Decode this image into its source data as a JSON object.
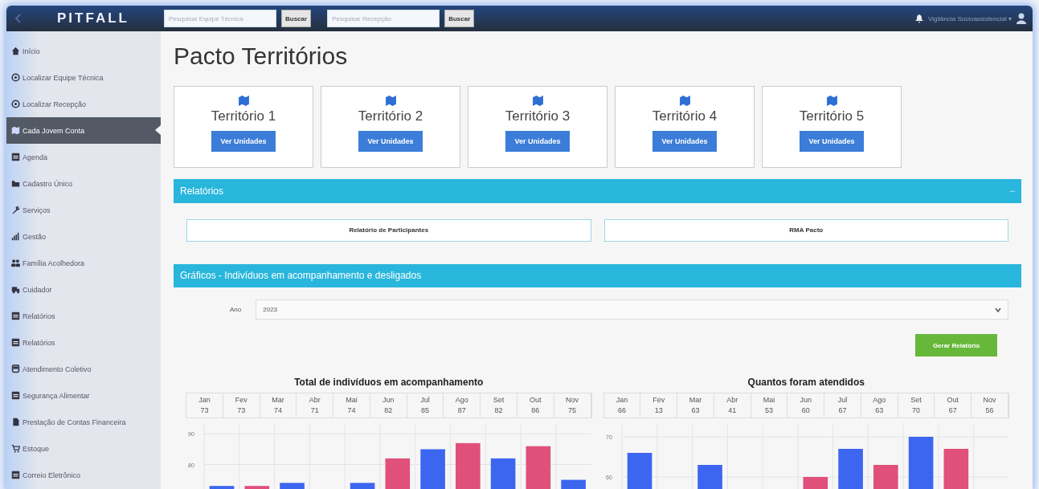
{
  "navbar": {
    "logo": "PITFALL",
    "searches": [
      {
        "placeholder": "Pesquisar Equipe Técnica",
        "button": "Buscar"
      },
      {
        "placeholder": "Pesquisar Recepção",
        "button": "Buscar"
      }
    ],
    "user": "Vigilância Socioassistencial",
    "user_caret": "▾"
  },
  "sidebar": {
    "items": [
      {
        "label": "Início",
        "kind": "home",
        "selected": false
      },
      {
        "label": "Localizar Equipe Técnica",
        "kind": "circle",
        "selected": false
      },
      {
        "label": "Localizar Recepção",
        "kind": "circle",
        "selected": false
      },
      {
        "label": "Cada Jovem Conta",
        "kind": "map",
        "selected": true
      },
      {
        "label": "Agenda",
        "kind": "list",
        "selected": false
      },
      {
        "label": "Cadastro Único",
        "kind": "folder",
        "selected": false
      },
      {
        "label": "Serviços",
        "kind": "wrench",
        "selected": false
      },
      {
        "label": "Gestão",
        "kind": "chart",
        "selected": false
      },
      {
        "label": "Família Acolhedora",
        "kind": "users",
        "selected": false
      },
      {
        "label": "Cuidador",
        "kind": "truck",
        "selected": false
      },
      {
        "label": "Relatórios",
        "kind": "list",
        "selected": false
      },
      {
        "label": "Relatórios",
        "kind": "list",
        "selected": false
      },
      {
        "label": "Atendimento Coletivo",
        "kind": "bus",
        "selected": false
      },
      {
        "label": "Segurança Alimentar",
        "kind": "list",
        "selected": false
      },
      {
        "label": "Prestação de Contas Financeira",
        "kind": "file",
        "selected": false
      },
      {
        "label": "Estoque",
        "kind": "cart",
        "selected": false
      },
      {
        "label": "Correio Eletrônico",
        "kind": "list",
        "selected": false
      }
    ]
  },
  "page": {
    "title": "Pacto Territórios",
    "territories": [
      {
        "name": "Território 1",
        "button": "Ver Unidades"
      },
      {
        "name": "Território 2",
        "button": "Ver Unidades"
      },
      {
        "name": "Território 3",
        "button": "Ver Unidades"
      },
      {
        "name": "Território 4",
        "button": "Ver Unidades"
      },
      {
        "name": "Território 5",
        "button": "Ver Unidades"
      }
    ],
    "reports_panel": {
      "title": "Relatórios",
      "collapse": "−",
      "buttons": [
        "Relatório de Participantes",
        "RMA Pacto"
      ]
    },
    "charts_panel": {
      "title": "Gráficos - Indivíduos em acompanhamento e desligados",
      "year_label": "Ano",
      "year": "2023",
      "generate_button": "Gerar Relatório",
      "charts": [
        {
          "title": "Total de indivíduos em acompanhamento",
          "months": [
            "Jan",
            "Fev",
            "Mar",
            "Abr",
            "Mai",
            "Jun",
            "Jul",
            "Ago",
            "Set",
            "Out",
            "Nov"
          ],
          "counts": [
            "73",
            "73",
            "74",
            "71",
            "74",
            "82",
            "85",
            "87",
            "82",
            "86",
            "75"
          ],
          "chart_data": {
            "type": "bar",
            "ylim": [
              72,
              93
            ],
            "yticks": [
              80,
              90
            ],
            "series": [
              {
                "color": "#3d66f0",
                "values": [
                  73,
                  null,
                  74,
                  null,
                  74,
                  null,
                  85,
                  null,
                  82,
                  null,
                  75
                ]
              },
              {
                "color": "#e0507a",
                "values": [
                  null,
                  73,
                  null,
                  null,
                  null,
                  82,
                  null,
                  87,
                  null,
                  86,
                  null
                ]
              }
            ]
          }
        },
        {
          "title": "Quantos foram atendidos",
          "months": [
            "Jan",
            "Fev",
            "Mar",
            "Abr",
            "Mai",
            "Jun",
            "Jul",
            "Ago",
            "Set",
            "Out",
            "Nov"
          ],
          "counts": [
            "66",
            "13",
            "63",
            "41",
            "53",
            "60",
            "67",
            "63",
            "70",
            "67",
            "56"
          ],
          "chart_data": {
            "type": "bar",
            "ylim": [
              57,
              73
            ],
            "yticks": [
              60,
              70
            ],
            "series": [
              {
                "color": "#3d66f0",
                "values": [
                  66,
                  null,
                  63,
                  null,
                  null,
                  null,
                  67,
                  null,
                  70,
                  null,
                  null
                ]
              },
              {
                "color": "#e0507a",
                "values": [
                  null,
                  null,
                  null,
                  null,
                  null,
                  60,
                  null,
                  63,
                  null,
                  67,
                  null
                ]
              }
            ]
          }
        }
      ]
    }
  }
}
